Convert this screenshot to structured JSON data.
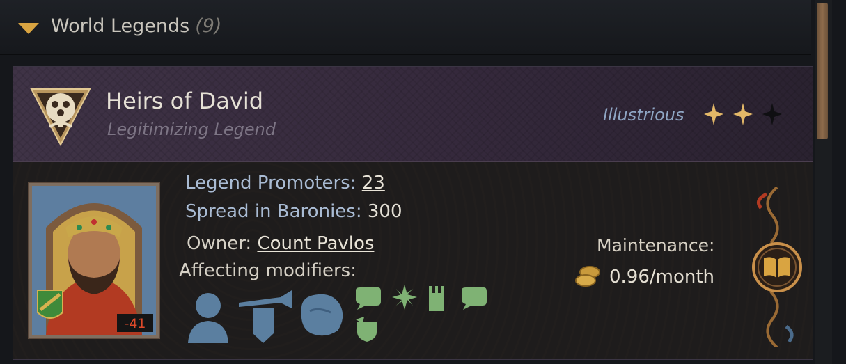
{
  "header": {
    "title": "World Legends",
    "count": "(9)"
  },
  "legend": {
    "name": "Heirs of David",
    "type": "Legitimizing Legend",
    "quality": "Illustrious",
    "stars_filled": 2,
    "stars_total": 3
  },
  "stats": {
    "promoters_label": "Legend Promoters:",
    "promoters_value": "23",
    "spread_label": "Spread in Baronies:",
    "spread_value": "300",
    "owner_label": "Owner:",
    "owner_value": "Count Pavlos",
    "modifiers_label": "Affecting modifiers:"
  },
  "portrait": {
    "badge": "-41"
  },
  "maintenance": {
    "label": "Maintenance:",
    "value": "0.96/month"
  },
  "modifier_icons": [
    "person-silhouette-icon",
    "trumpet-banner-icon",
    "rock-map-icon",
    "speech-bubble-icon",
    "sparkle-icon",
    "tower-icon",
    "speech-bubble-icon",
    "shield-arrow-icon"
  ],
  "colors": {
    "accent_gold": "#d9a441",
    "label_blue": "#a9bbd3",
    "icon_blue": "#5b7fa0",
    "icon_green": "#7fb274"
  }
}
